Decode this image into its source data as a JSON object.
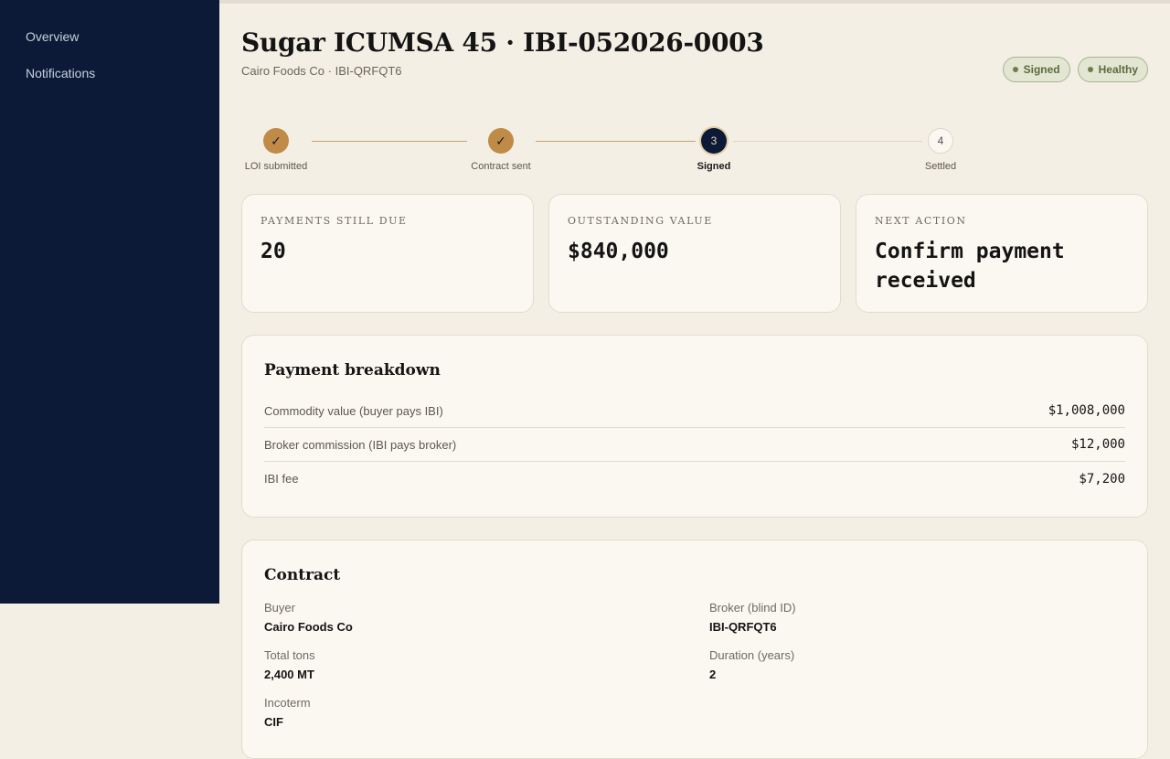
{
  "sidebar": {
    "items": [
      {
        "label": "Overview"
      },
      {
        "label": "Notifications"
      }
    ]
  },
  "header": {
    "title": "Sugar ICUMSA 45 · IBI-052026-0003",
    "subtitle": "Cairo Foods Co · IBI-QRFQT6",
    "badges": [
      {
        "label": "Signed"
      },
      {
        "label": "Healthy"
      }
    ]
  },
  "stepper": {
    "steps": [
      {
        "label": "LOI submitted",
        "marker": "✓",
        "state": "done"
      },
      {
        "label": "Contract sent",
        "marker": "✓",
        "state": "done"
      },
      {
        "label": "Signed",
        "marker": "3",
        "state": "active"
      },
      {
        "label": "Settled",
        "marker": "4",
        "state": "todo"
      }
    ]
  },
  "stats": [
    {
      "label": "PAYMENTS STILL DUE",
      "value": "20"
    },
    {
      "label": "OUTSTANDING VALUE",
      "value": "$840,000"
    },
    {
      "label": "NEXT ACTION",
      "value": "Confirm payment received"
    }
  ],
  "breakdown": {
    "title": "Payment breakdown",
    "rows": [
      {
        "label": "Commodity value (buyer pays IBI)",
        "value": "$1,008,000"
      },
      {
        "label": "Broker commission (IBI pays broker)",
        "value": "$12,000"
      },
      {
        "label": "IBI fee",
        "value": "$7,200"
      }
    ]
  },
  "contract": {
    "title": "Contract",
    "fields": [
      {
        "label": "Buyer",
        "value": "Cairo Foods Co"
      },
      {
        "label": "Broker (blind ID)",
        "value": "IBI-QRFQT6"
      },
      {
        "label": "Total tons",
        "value": "2,400 MT"
      },
      {
        "label": "Duration (years)",
        "value": "2"
      },
      {
        "label": "Incoterm",
        "value": "CIF"
      }
    ]
  },
  "colors": {
    "sidebar": "#0c1a38",
    "accent": "#c08a47",
    "background": "#f4efe5",
    "badge": "#e2e6d2"
  }
}
